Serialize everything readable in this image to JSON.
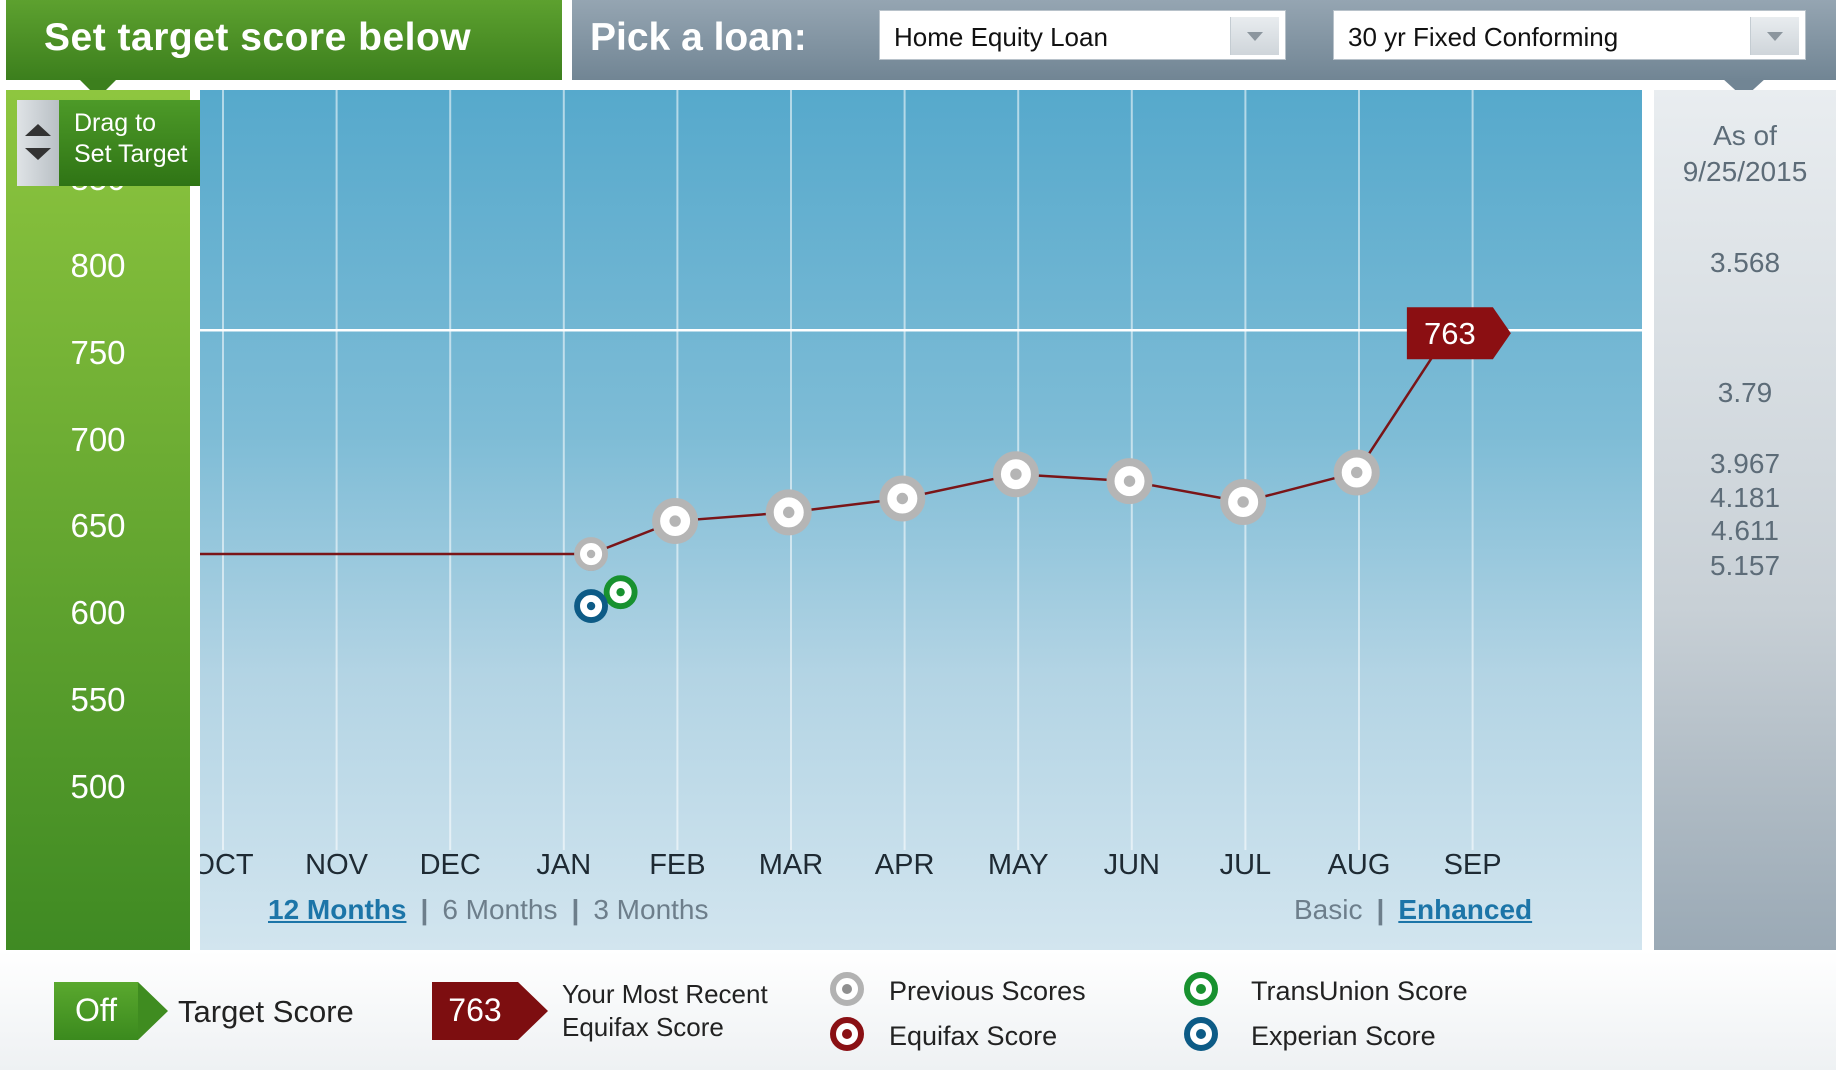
{
  "header": {
    "target_title": "Set target score below",
    "loan_label": "Pick a loan:",
    "loan_type": "Home Equity Loan",
    "loan_term": "30 yr Fixed Conforming"
  },
  "target_handle": {
    "line1": "Drag to",
    "line2": "Set Target"
  },
  "rates": {
    "as_of_line1": "As of",
    "as_of_line2": "9/25/2015",
    "values": [
      {
        "rate": "3.568",
        "score": 802
      },
      {
        "rate": "3.79",
        "score": 727
      },
      {
        "rate": "3.967",
        "score": 686
      },
      {
        "rate": "4.181",
        "score": 666
      },
      {
        "rate": "4.611",
        "score": 647
      },
      {
        "rate": "5.157",
        "score": 627
      }
    ]
  },
  "chart_data": {
    "type": "line",
    "categories": [
      "OCT",
      "NOV",
      "DEC",
      "JAN",
      "FEB",
      "MAR",
      "APR",
      "MAY",
      "JUN",
      "JUL",
      "AUG",
      "SEP"
    ],
    "y_ticks": [
      800,
      750,
      700,
      650,
      600,
      550,
      500
    ],
    "y_partial_tick": "850",
    "ylim": [
      447,
      878
    ],
    "target_score": 763,
    "grid": "vertical",
    "equifax_series": {
      "flat_before": {
        "x_start": -0.4,
        "x_end": 3.24,
        "value": 634
      },
      "points": [
        {
          "x": 3.24,
          "value": 634,
          "kind": "previous"
        },
        {
          "x": 3.98,
          "value": 653,
          "kind": "previous"
        },
        {
          "x": 4.98,
          "value": 658,
          "kind": "previous"
        },
        {
          "x": 5.98,
          "value": 666,
          "kind": "previous"
        },
        {
          "x": 6.98,
          "value": 680,
          "kind": "previous"
        },
        {
          "x": 7.98,
          "value": 676,
          "kind": "previous"
        },
        {
          "x": 8.98,
          "value": 664,
          "kind": "previous"
        },
        {
          "x": 9.98,
          "value": 681,
          "kind": "previous"
        },
        {
          "x": 10.8,
          "value": 763,
          "kind": "latest",
          "label": "763"
        }
      ]
    },
    "transunion_points": [
      {
        "x": 3.5,
        "value": 612
      }
    ],
    "experian_points": [
      {
        "x": 3.24,
        "value": 604
      }
    ],
    "colors": {
      "line": "#7a1518",
      "latest": "#8b0f12",
      "previous_ring": "#b2b2b2",
      "transunion": "#18912f",
      "experian": "#0d5b86"
    }
  },
  "time_ranges": {
    "items": [
      "12 Months",
      "6 Months",
      "3 Months"
    ],
    "active": "12 Months"
  },
  "views": {
    "items": [
      "Basic",
      "Enhanced"
    ],
    "active": "Enhanced"
  },
  "legend": {
    "off_label": "Off",
    "target_label": "Target Score",
    "latest_value": "763",
    "latest_line1": "Your Most Recent",
    "latest_line2": "Equifax Score",
    "previous": "Previous Scores",
    "equifax": "Equifax Score",
    "transunion": "TransUnion Score",
    "experian": "Experian Score"
  }
}
